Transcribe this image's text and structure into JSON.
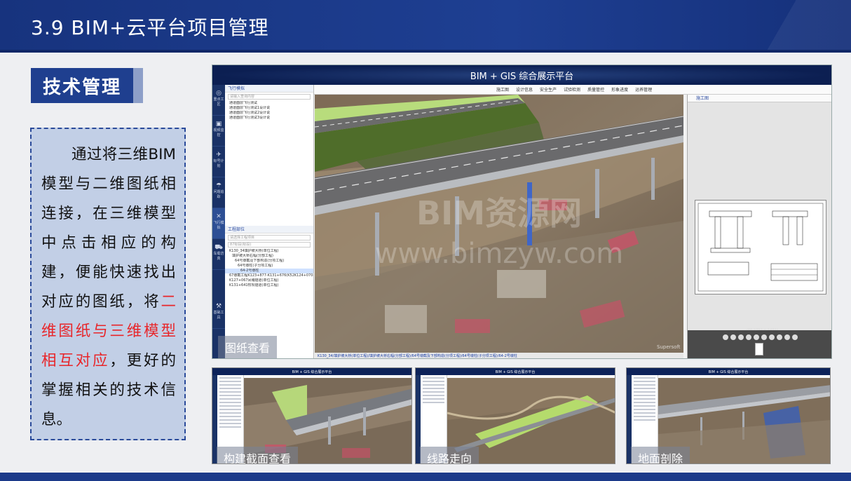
{
  "slide": {
    "title": "3.9 BIM+云平台项目管理",
    "section_label": "技术管理",
    "description_part1": "通过将三维BIM模型与二维图纸相连接，在三维模型中点击相应的构建，便能快速找出对应的图纸，将",
    "description_highlight": "二维图纸与三维模型相互对应",
    "description_part2": "，更好的掌握相关的技术信息。",
    "highlight_color": "#e8262a",
    "brand_color": "#1f3f8f"
  },
  "main_screenshot": {
    "caption": "图纸查看",
    "app_title": "BIM + GIS 综合展示平台",
    "toolbar_items": [
      "施工图",
      "设计信息",
      "安全生产",
      "试验检测",
      "质量管控",
      "形象进度",
      "运养管理"
    ],
    "side_icons": [
      {
        "icon": "target-icon",
        "label": "重点工区"
      },
      {
        "icon": "camera-icon",
        "label": "视频监控"
      },
      {
        "icon": "plane-icon",
        "label": "标号计划"
      },
      {
        "icon": "rain-icon",
        "label": "问题追踪"
      },
      {
        "icon": "tools-icon",
        "label": "飞行模拟"
      },
      {
        "icon": "car-icon",
        "label": "车载仿真"
      },
      {
        "icon": "wrench-icon",
        "label": "基础工具"
      }
    ],
    "fly_panel_title": "飞行模拟",
    "fly_search_placeholder": "请输入查询内容",
    "fly_items": [
      "通道面层飞行测试",
      "通道面层飞行测试1设计说",
      "通道面层飞行测试2设计说",
      "通道面层飞行测试3设计说"
    ],
    "project_panel_title": "工程部位",
    "project_select": "请选择工程项目",
    "project_tag": "87标段(标段)",
    "project_items": [
      "K130_34填护坡大桥(单位工程)",
      "填护坡大桥右幅(分部工程)",
      "64号墩截及下部构造(分项工程)",
      "64号墩柱(子分项工程)",
      "64-2号墩柱",
      "67墩截工程K123+877-K131+676(K52K124+070-2)",
      "K127+067凤埔隧道(单位工程)",
      "K131+641牧坝隧道(单位工程)"
    ],
    "drawing_panel_title": "施工图",
    "drawing_scale": "(66.1092 × 1481)",
    "status_path": "K130_34/填护坡大桥(单位工程)/填护坡大桥右幅(分部工程)/64号墩截及下部构造(分项工程)/64号墩柱(子分项工程)/64-2号墩柱",
    "watermark_logo": "BIM资源网",
    "watermark_url": "www.bimzyw.com",
    "view_brand": "Supersoft"
  },
  "sub_screenshots": [
    {
      "caption": "构建截面查看",
      "app_title": "BIM + GIS 综合展示平台"
    },
    {
      "caption": "线路走向",
      "app_title": "BIM + GIS 综合展示平台"
    },
    {
      "caption": "地面剖除",
      "app_title": "BIM + GIS 综合展示平台"
    }
  ]
}
